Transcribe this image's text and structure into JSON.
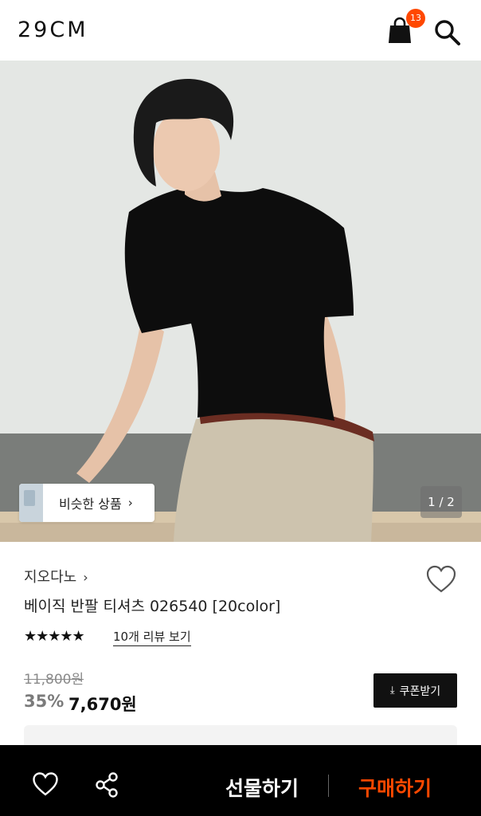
{
  "header": {
    "logo": "29CM",
    "cart_count": "13",
    "icons": [
      "shopping-bag-icon",
      "search-icon"
    ]
  },
  "hero": {
    "similar_label": "비슷한 상품",
    "similar_chevron": "›",
    "pager": "1 / 2"
  },
  "product": {
    "brand": "지오다노",
    "brand_chevron": "›",
    "title": "베이직 반팔 티셔츠 026540 [20color]",
    "stars": "★★★★★",
    "rating": 5,
    "reviews": "10개 리뷰 보기",
    "original_price": "11,800원",
    "discount": "35%",
    "price": "7,670원"
  },
  "coupon": {
    "icon": "⤓",
    "label": "쿠폰받기"
  },
  "bottom_bar": {
    "gift_label": "선물하기",
    "buy_label": "구매하기"
  },
  "colors": {
    "accent": "#ff4800",
    "black": "#000000"
  }
}
